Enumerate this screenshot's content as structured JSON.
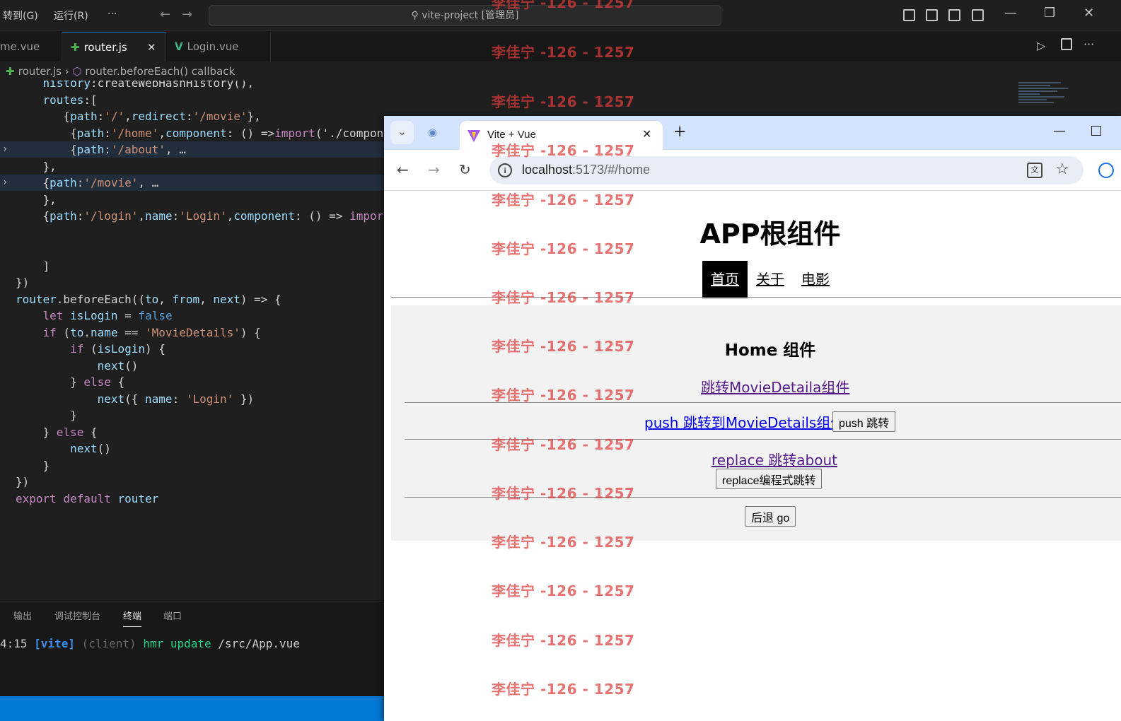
{
  "vscode": {
    "menus": [
      "转到(G)",
      "运行(R)",
      "···"
    ],
    "command_center": "vite-project [管理员]",
    "tabs": [
      {
        "label": "me.vue",
        "icon": ""
      },
      {
        "label": "router.js",
        "icon": "✚",
        "close": "✕"
      },
      {
        "label": "Login.vue",
        "icon": "V"
      }
    ],
    "breadcrumb": {
      "file": "router.js",
      "sep": "›",
      "symbol": "router.beforeEach() callback"
    },
    "code_lines": [
      "    history:createWebHashHistory(),",
      "    routes:[",
      "       {path:'/',redirect:'/movie'},",
      "        {path:'/home',component: () =>import('./compone",
      "        {path:'/about', …",
      "    },",
      "    {path:'/movie', …",
      "    },",
      "    {path:'/login',name:'Login',component: () => import",
      "",
      "",
      "    ]",
      "})",
      "router.beforeEach((to, from, next) => {",
      "    let isLogin = false",
      "    if (to.name == 'MovieDetails') {",
      "        if (isLogin) {",
      "            next()",
      "        } else {",
      "            next({ name: 'Login' })",
      "        }",
      "    } else {",
      "        next()",
      "    }",
      "})",
      "export default router"
    ],
    "panel_tabs": [
      "输出",
      "调试控制台",
      "终端",
      "端口"
    ],
    "terminal_line": "4:15 [vite] (client) hmr update /src/App.vue"
  },
  "browser": {
    "tab_title": "Vite + Vue",
    "tab_close": "✕",
    "new_tab": "+",
    "url_host": "localhost",
    "url_path": ":5173/#/home",
    "page": {
      "app_title": "APP根组件",
      "nav": [
        "首页",
        "关于",
        "电影"
      ],
      "home_title": "Home 组件",
      "link1": "跳转MovieDetaila组件",
      "link2": "push 跳转到MovieDetails组件",
      "btn_push": "push 跳转",
      "link3": "replace 跳转about",
      "btn_replace": "replace编程式跳转",
      "btn_back": "后退 go"
    }
  },
  "watermark": "李佳宁 -126 - 1257"
}
